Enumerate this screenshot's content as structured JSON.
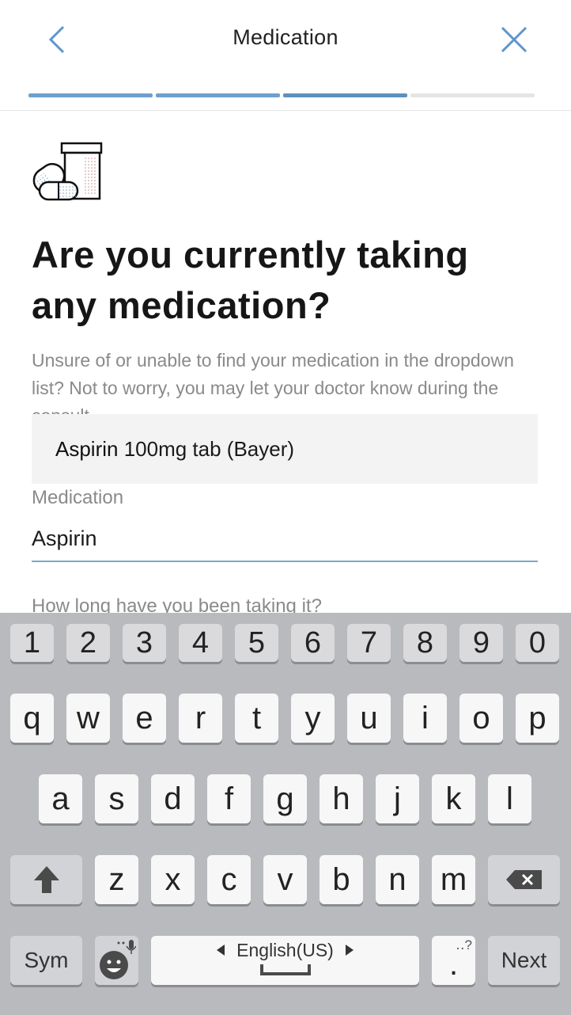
{
  "header": {
    "title": "Medication",
    "progress_steps": [
      {
        "state": "done"
      },
      {
        "state": "done"
      },
      {
        "state": "current"
      },
      {
        "state": "todo"
      }
    ]
  },
  "content": {
    "question": "Are you currently taking any medication?",
    "hint": "Unsure of or unable to find your medication in the dropdown list? Not to worry, you may let your doctor know during the consult.",
    "suggestion": {
      "match": "Aspirin",
      "rest": " 100mg tab (Bayer)"
    },
    "field_label": "Medication",
    "field_value": "Aspirin",
    "next_question": "How long have you been taking it?"
  },
  "keyboard": {
    "numbers": [
      "1",
      "2",
      "3",
      "4",
      "5",
      "6",
      "7",
      "8",
      "9",
      "0"
    ],
    "row1": [
      "q",
      "w",
      "e",
      "r",
      "t",
      "y",
      "u",
      "i",
      "o",
      "p"
    ],
    "row2": [
      "a",
      "s",
      "d",
      "f",
      "g",
      "h",
      "j",
      "k",
      "l"
    ],
    "row3": [
      "z",
      "x",
      "c",
      "v",
      "b",
      "n",
      "m"
    ],
    "sym_label": "Sym",
    "language_label": "English(US)",
    "period_label": ".",
    "punct_hint": "․․?",
    "next_label": "Next"
  },
  "colors": {
    "accent": "#6f9fce",
    "keyboard_bg": "#b9babe",
    "key_bg": "#f7f7f7"
  }
}
